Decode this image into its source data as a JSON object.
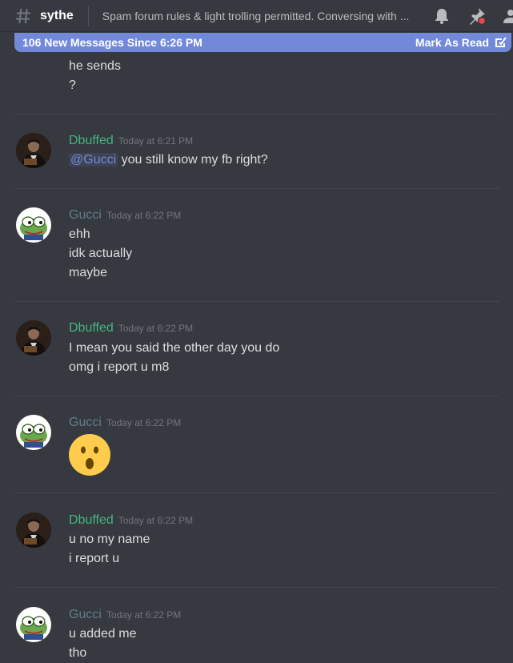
{
  "header": {
    "channel_name": "sythe",
    "topic": "Spam forum rules & light trolling permitted. Conversing with ..."
  },
  "new_messages_bar": {
    "text": "106 New Messages Since 6:26 PM",
    "mark_label": "Mark As Read"
  },
  "messages": {
    "g0": {
      "lines": [
        "he sends",
        "?"
      ]
    },
    "g1": {
      "author": "Dbuffed",
      "time": "Today at 6:21 PM",
      "mention": "@Gucci",
      "line1_rest": " you still know my fb right?"
    },
    "g2": {
      "author": "Gucci",
      "time": "Today at 6:22 PM",
      "lines": [
        "ehh",
        "idk actually",
        "maybe"
      ]
    },
    "g3": {
      "author": "Dbuffed",
      "time": "Today at 6:22 PM",
      "lines": [
        "I mean you said the other day you do",
        "omg i report u m8"
      ]
    },
    "g4": {
      "author": "Gucci",
      "time": "Today at 6:22 PM",
      "emoji": "hushed-face"
    },
    "g5": {
      "author": "Dbuffed",
      "time": "Today at 6:22 PM",
      "lines": [
        "u no my name",
        "i report u"
      ]
    },
    "g6": {
      "author": "Gucci",
      "time": "Today at 6:22 PM",
      "lines": [
        "u added me",
        "tho"
      ]
    }
  },
  "icons": {
    "hash": "channel-hash-icon",
    "bell": "bell-icon",
    "pin": "pin-icon",
    "members": "members-icon",
    "mark_read": "mark-read-icon"
  },
  "colors": {
    "background": "#36393f",
    "new_bar": "#7289da",
    "dbuffed_name": "#43b581",
    "gucci_name": "#607d8b",
    "mention": "#7289da",
    "pin_badge": "#f04747"
  }
}
